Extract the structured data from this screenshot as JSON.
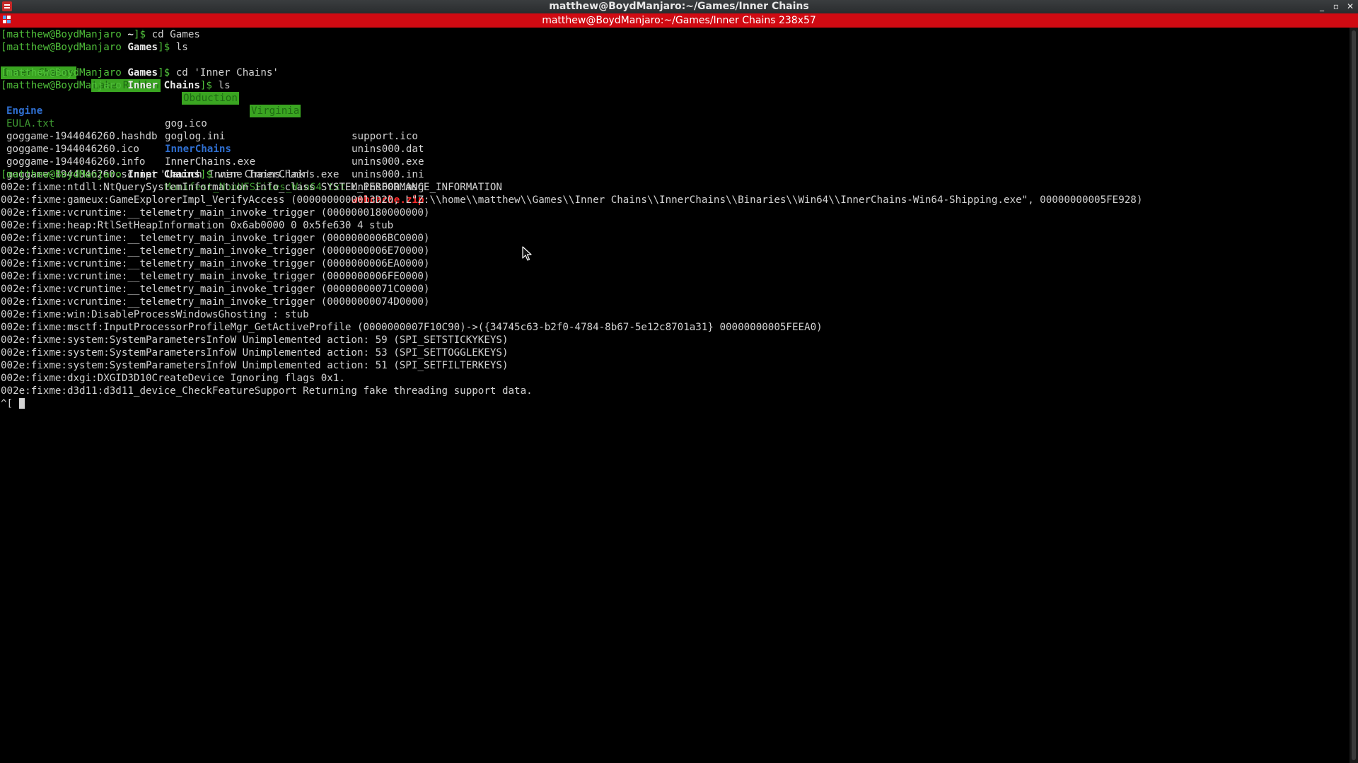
{
  "window": {
    "title": "matthew@BoydManjaro:~/Games/Inner Chains",
    "buttons": {
      "minimize": "_",
      "maximize": "▫",
      "close": "✕"
    }
  },
  "tab": {
    "title": "matthew@BoydManjaro:~/Games/Inner Chains 238x57"
  },
  "terminal": {
    "prompt_user": "matthew@BoydManjaro",
    "prompts": {
      "p1": {
        "dir": "~",
        "cmd": "cd Games"
      },
      "p2": {
        "dir": "Games",
        "cmd": "ls"
      },
      "p3": {
        "dir": "Games",
        "cmd": "cd 'Inner Chains'"
      },
      "p4": {
        "dir": "Inner Chains",
        "cmd": "ls"
      },
      "p5": {
        "dir": "Inner Chains",
        "cmd": "wine InnerChains.exe"
      }
    },
    "games_ls": [
      "Inner Chains",
      "Lake Ridden",
      "Obduction",
      "Virginia"
    ],
    "ls_col1": [
      "Engine",
      "EULA.txt",
      "goggame-1944046260.hashdb",
      "goggame-1944046260.ico",
      "goggame-1944046260.info",
      "goggame-1944046260.script"
    ],
    "ls_col2": [
      "gog.ico",
      "goglog.ini",
      "InnerChains",
      "InnerChains.exe",
      "'Launch Inner Chains.lnk'",
      "Manifest_NonUFSFiles_Win64.txt"
    ],
    "ls_col3": [
      "support.ico",
      "unins000.dat",
      "unins000.exe",
      "unins000.ini",
      "unins000.msg",
      "webcache.zip"
    ],
    "output": [
      "002e:fixme:ntdll:NtQuerySystemInformation info_class SYSTEM_PERFORMANCE_INFORMATION",
      "002e:fixme:gameux:GameExplorerImpl_VerifyAccess (0000000000013D20, L\"Z:\\\\home\\\\matthew\\\\Games\\\\Inner Chains\\\\InnerChains\\\\Binaries\\\\Win64\\\\InnerChains-Win64-Shipping.exe\", 00000000005FE928)",
      "002e:fixme:vcruntime:__telemetry_main_invoke_trigger (0000000180000000)",
      "002e:fixme:heap:RtlSetHeapInformation 0x6ab0000 0 0x5fe630 4 stub",
      "002e:fixme:vcruntime:__telemetry_main_invoke_trigger (0000000006BC0000)",
      "002e:fixme:vcruntime:__telemetry_main_invoke_trigger (0000000006E70000)",
      "002e:fixme:vcruntime:__telemetry_main_invoke_trigger (0000000006EA0000)",
      "002e:fixme:vcruntime:__telemetry_main_invoke_trigger (0000000006FE0000)",
      "002e:fixme:vcruntime:__telemetry_main_invoke_trigger (00000000071C0000)",
      "002e:fixme:vcruntime:__telemetry_main_invoke_trigger (00000000074D0000)",
      "002e:fixme:win:DisableProcessWindowsGhosting : stub",
      "002e:fixme:msctf:InputProcessorProfileMgr_GetActiveProfile (0000000007F10C90)->({34745c63-b2f0-4784-8b67-5e12c8701a31} 00000000005FEEA0)",
      "002e:fixme:system:SystemParametersInfoW Unimplemented action: 59 (SPI_SETSTICKYKEYS)",
      "002e:fixme:system:SystemParametersInfoW Unimplemented action: 53 (SPI_SETTOGGLEKEYS)",
      "002e:fixme:system:SystemParametersInfoW Unimplemented action: 51 (SPI_SETFILTERKEYS)",
      "002e:fixme:dxgi:DXGID3D10CreateDevice Ignoring flags 0x1.",
      "002e:fixme:d3d11:d3d11_device_CheckFeatureSupport Returning fake threading support data."
    ],
    "last_input": "^["
  },
  "colors": {
    "prompt_green": "#4fbf3a",
    "directory_blue": "#2f6fd1",
    "archive_red": "#ff2a2a",
    "tab_red": "#d00a12"
  }
}
